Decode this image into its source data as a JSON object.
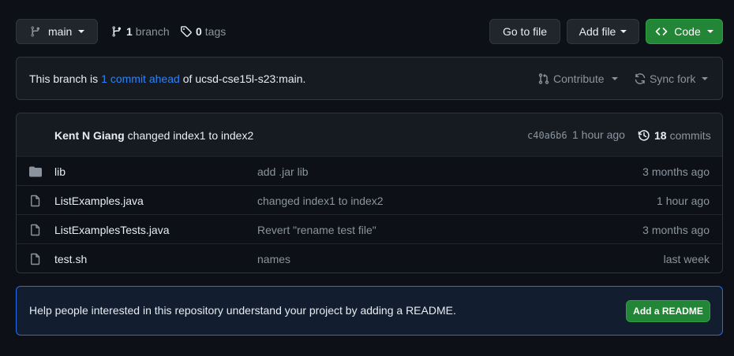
{
  "toolbar": {
    "branch_select": "main",
    "branch_count": "1",
    "branch_label": "branch",
    "tag_count": "0",
    "tag_label": "tags",
    "go_to_file": "Go to file",
    "add_file": "Add file",
    "code": "Code"
  },
  "status": {
    "prefix": "This branch is",
    "link": "1 commit ahead",
    "suffix": "of ucsd-cse15l-s23:main.",
    "contribute": "Contribute",
    "sync_fork": "Sync fork"
  },
  "commit": {
    "author": "Kent N Giang",
    "message": "changed index1 to index2",
    "sha": "c40a6b6",
    "age": "1 hour ago",
    "count": "18",
    "count_label": "commits"
  },
  "files": [
    {
      "type": "folder",
      "name": "lib",
      "message": "add .jar lib",
      "age": "3 months ago"
    },
    {
      "type": "file",
      "name": "ListExamples.java",
      "message": "changed index1 to index2",
      "age": "1 hour ago"
    },
    {
      "type": "file",
      "name": "ListExamplesTests.java",
      "message": "Revert \"rename test file\"",
      "age": "3 months ago"
    },
    {
      "type": "file",
      "name": "test.sh",
      "message": "names",
      "age": "last week"
    }
  ],
  "readme": {
    "text": "Help people interested in this repository understand your project by adding a README.",
    "button": "Add a README"
  },
  "colors": {
    "accent": "#2f81f7",
    "success": "#238636",
    "background": "#0d1117"
  }
}
